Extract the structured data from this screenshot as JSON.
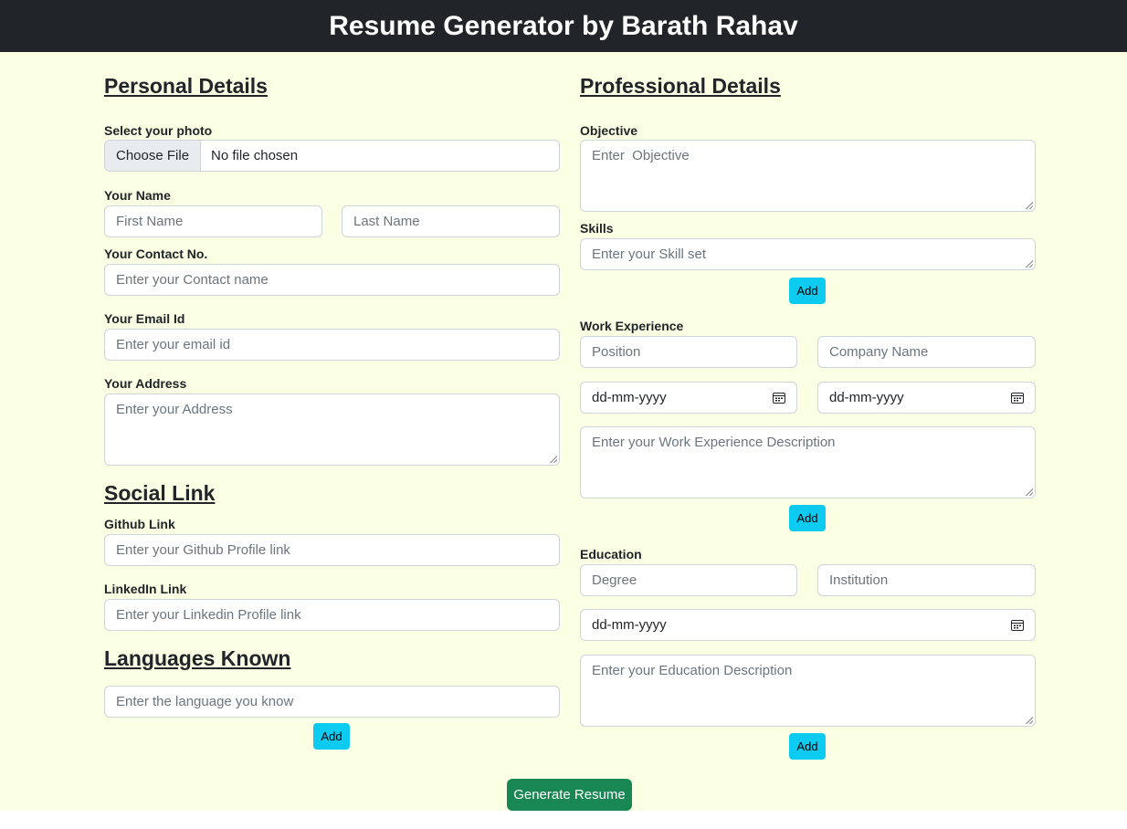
{
  "header": {
    "title": "Resume Generator by Barath Rahav"
  },
  "personal": {
    "title": "Personal Details",
    "photo_label": "Select your photo",
    "choose_file": "Choose File",
    "no_file": "No file chosen",
    "name_label": "Your Name",
    "first_name_placeholder": "First Name",
    "last_name_placeholder": "Last Name",
    "contact_label": "Your Contact No.",
    "contact_placeholder": "Enter your Contact name",
    "email_label": "Your Email Id",
    "email_placeholder": "Enter your email id",
    "address_label": "Your Address",
    "address_placeholder": "Enter your Address"
  },
  "social": {
    "title": "Social Link",
    "github_label": "Github Link",
    "github_placeholder": "Enter your Github Profile link",
    "linkedin_label": "LinkedIn Link",
    "linkedin_placeholder": "Enter your Linkedin Profile link"
  },
  "languages": {
    "title": "Languages Known",
    "placeholder": "Enter the language you know",
    "add": "Add"
  },
  "professional": {
    "title": "Professional Details",
    "objective_label": "Objective",
    "objective_placeholder": "Enter  Objective",
    "skills_label": "Skills",
    "skills_placeholder": "Enter your Skill set",
    "skills_add": "Add"
  },
  "work": {
    "label": "Work Experience",
    "position_placeholder": "Position",
    "company_placeholder": "Company Name",
    "start_date": "dd-mm-yyyy",
    "end_date": "dd-mm-yyyy",
    "description_placeholder": "Enter your Work Experience Description",
    "add": "Add"
  },
  "education": {
    "label": "Education",
    "degree_placeholder": "Degree",
    "institution_placeholder": "Institution",
    "date": "dd-mm-yyyy",
    "description_placeholder": "Enter your Education Description",
    "add": "Add"
  },
  "actions": {
    "generate": "Generate Resume"
  },
  "colors": {
    "header_bg": "#212529",
    "page_bg": "#fbffe3",
    "add_button": "#0dcaf0",
    "generate_button": "#198754"
  },
  "icons": {
    "date_picker": "calendar-icon"
  }
}
